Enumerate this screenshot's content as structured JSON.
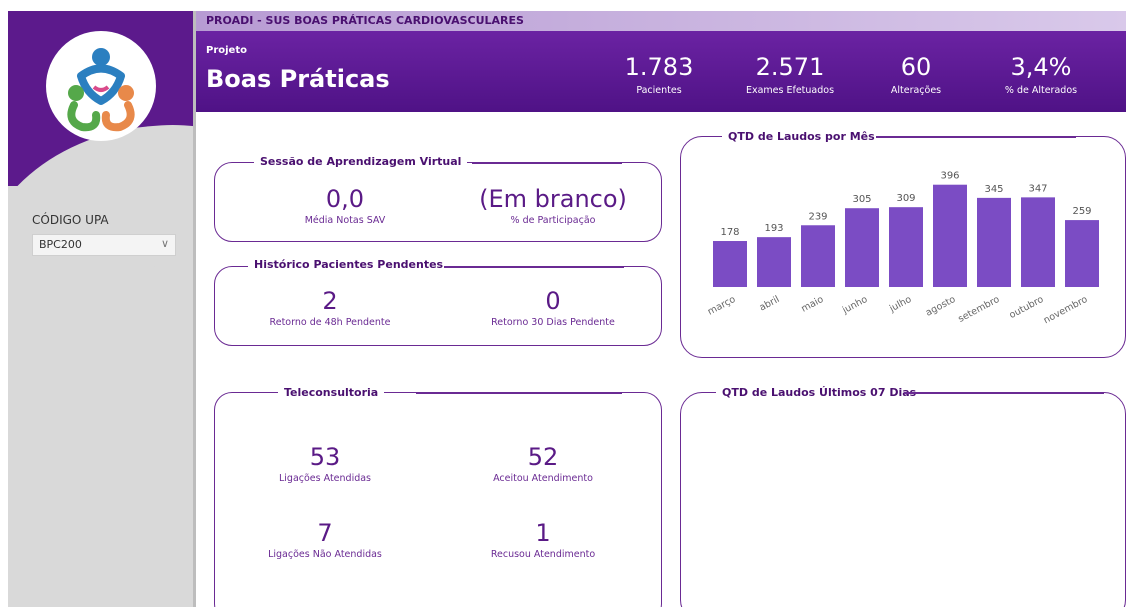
{
  "header": {
    "strip_title": "PROADI - SUS BOAS PRÁTICAS CARDIOVASCULARES",
    "project_label": "Projeto",
    "project_title": "Boas Práticas",
    "kpis": [
      {
        "value": "1.783",
        "label": "Pacientes"
      },
      {
        "value": "2.571",
        "label": "Exames Efetuados"
      },
      {
        "value": "60",
        "label": "Alterações"
      },
      {
        "value": "3,4%",
        "label": "% de Alterados"
      }
    ]
  },
  "sidebar": {
    "filter_label": "CÓDIGO UPA",
    "filter_value": "BPC200"
  },
  "sav": {
    "title": "Sessão de Aprendizagem Virtual",
    "metrics": [
      {
        "value": "0,0",
        "label": "Média Notas SAV"
      },
      {
        "value": "(Em branco)",
        "label": "% de Participação"
      }
    ]
  },
  "historico": {
    "title": "Histórico Pacientes Pendentes",
    "metrics": [
      {
        "value": "2",
        "label": "Retorno de 48h Pendente"
      },
      {
        "value": "0",
        "label": "Retorno 30 Dias Pendente"
      }
    ]
  },
  "teleconsultoria": {
    "title": "Teleconsultoria",
    "metrics": [
      {
        "value": "53",
        "label": "Ligações Atendidas"
      },
      {
        "value": "52",
        "label": "Aceitou Atendimento"
      },
      {
        "value": "7",
        "label": "Ligações Não Atendidas"
      },
      {
        "value": "1",
        "label": "Recusou Atendimento"
      }
    ]
  },
  "ultimos7": {
    "title": "QTD de Laudos Últimos 07 Dias"
  },
  "chart_data": {
    "type": "bar",
    "title": "QTD de Laudos por Mês",
    "categories": [
      "março",
      "abril",
      "maio",
      "junho",
      "julho",
      "agosto",
      "setembro",
      "outubro",
      "novembro"
    ],
    "values": [
      178,
      193,
      239,
      305,
      309,
      396,
      345,
      347,
      259
    ],
    "bar_color": "#7b4cc4",
    "ylim": [
      0,
      420
    ],
    "grid": false
  },
  "colors": {
    "header": "#5c1a8c",
    "accent": "#6a2a93",
    "sidebar": "#d9d9d9"
  }
}
